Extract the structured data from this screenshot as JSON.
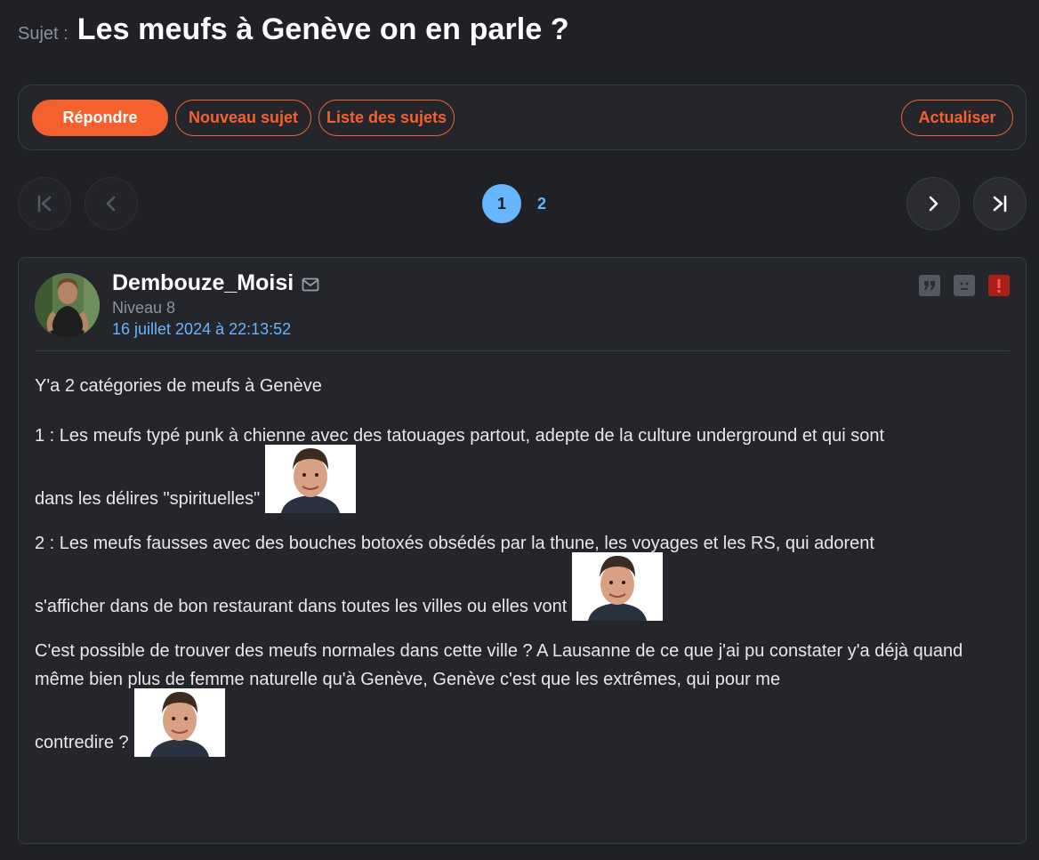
{
  "subject": {
    "label": "Sujet :",
    "title": "Les meufs à Genève on en parle ?"
  },
  "toolbar": {
    "reply": "Répondre",
    "new_topic": "Nouveau sujet",
    "topic_list": "Liste des sujets",
    "refresh": "Actualiser"
  },
  "pagination": {
    "current": "1",
    "pages": [
      "1",
      "2"
    ]
  },
  "post": {
    "author": "Dembouze_Moisi",
    "level": "Niveau 8",
    "date": "16 juillet 2024 à 22:13:52",
    "paragraphs": [
      "Y'a 2 catégories de meufs à Genève",
      "1 : Les meufs typé punk à chienne avec des tatouages partout, adepte de la culture underground et qui sont",
      "dans les délires \"spirituelles\"",
      "2 : Les meufs fausses avec des bouches botoxés obsédés par la thune, les voyages et les RS, qui adorent",
      "s'afficher dans de bon restaurant dans toutes les villes ou elles vont",
      "C'est possible de trouver des meufs normales dans cette ville ? A Lausanne de ce que j'ai pu constater y'a déjà quand même bien plus de femme naturelle qu'à Genève, Genève c'est que les extrêmes, qui pour me",
      "contredire ?"
    ]
  },
  "colors": {
    "accent": "#f4612f",
    "link": "#67b5ff",
    "background": "#1f2126",
    "alert": "#a8201a"
  },
  "icons": [
    "mail-icon",
    "quote-icon",
    "sad-face-icon",
    "report-icon",
    "first-page-icon",
    "prev-page-icon",
    "next-page-icon",
    "last-page-icon"
  ]
}
